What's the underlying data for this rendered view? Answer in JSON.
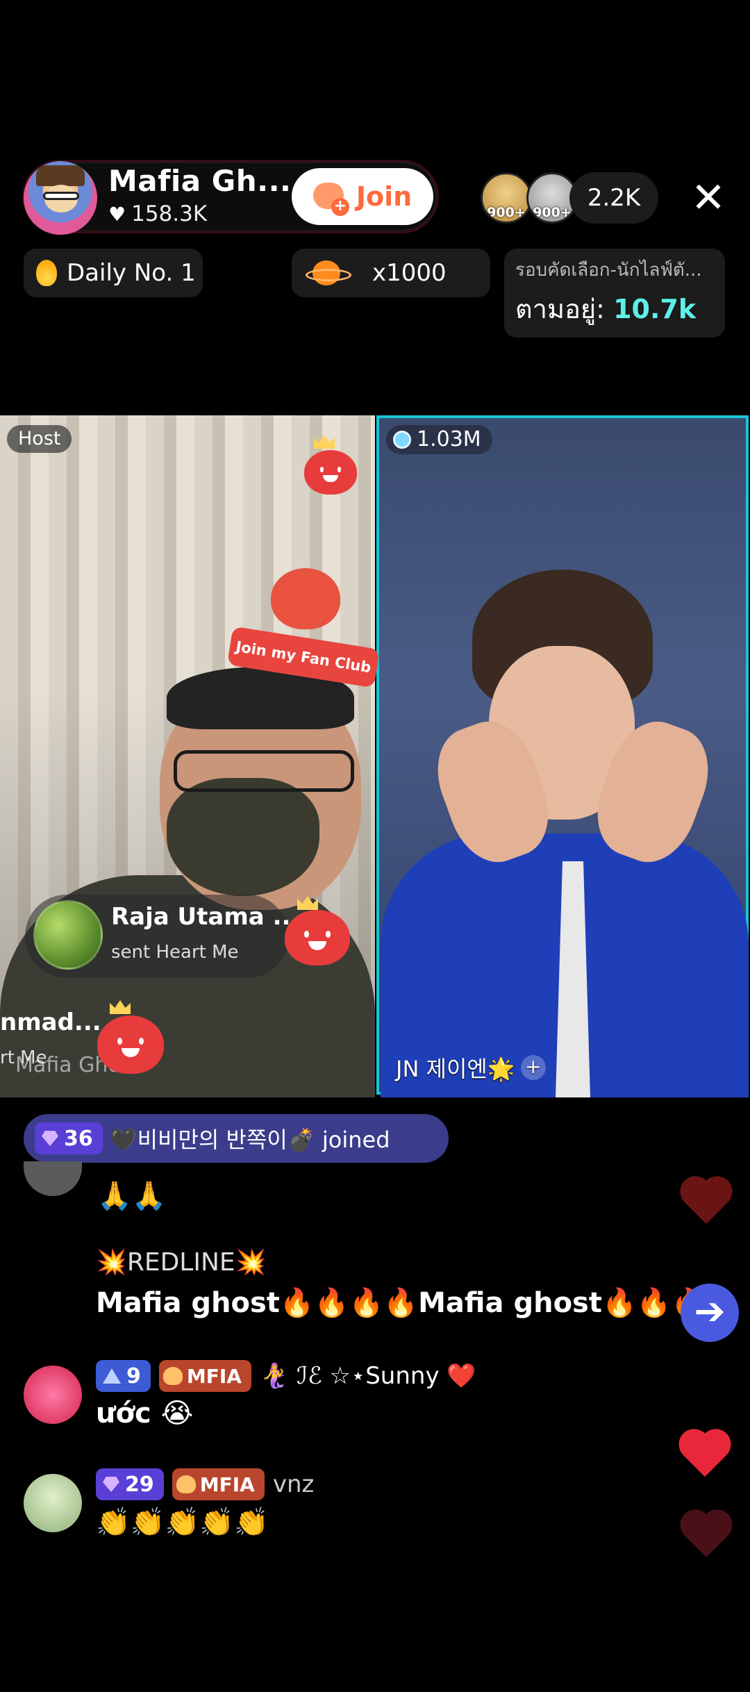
{
  "header": {
    "host_name": "Mafia Gh...",
    "host_likes": "158.3K",
    "join_label": "Join",
    "viewer_badges": [
      "900+",
      "900+"
    ],
    "viewer_count": "2.2K",
    "close_icon": "close-icon",
    "daily_rank": "Daily No. 1",
    "multiplier": "x1000",
    "ranking_title": "รอบคัดเลือก-นักไลฟ์ตั...",
    "ranking_label": "ตามอยู่:",
    "ranking_value": "10.7k"
  },
  "stream": {
    "host_tag": "Host",
    "guest_score": "1.03M",
    "guest_name": "JN 제이엔🌟",
    "fan_club_label": "Join my Fan Club",
    "gift": {
      "sender": "Raja Utama ...",
      "action": "sent Heart Me"
    },
    "gift2": {
      "sender": "nmad...",
      "action": "rt Me"
    },
    "watermark": "Mafia Ghost"
  },
  "chat": {
    "joined": {
      "level": "36",
      "text": "🖤비비만의 반쪽이💣 joined"
    },
    "messages": [
      {
        "user": "",
        "text": "🙏🙏"
      },
      {
        "user": "💥REDLINE💥",
        "text": "Mafia ghost🔥🔥🔥🔥Mafia ghost🔥🔥🔥🔥"
      },
      {
        "level": "9",
        "badge": "MFIA",
        "user": "🧜‍♀️ ℐℰ ☆⋆Sunny ❤️",
        "text": "ước 😭"
      },
      {
        "level": "29",
        "badge": "MFIA",
        "user": "vnz",
        "text": "👏👏👏👏👏"
      }
    ]
  },
  "colors": {
    "accent_cyan": "#17c6d8",
    "ranking_value": "#5ef0e8",
    "join_text": "#ff6a3d",
    "joined_pill": "#3b3d8c",
    "like_heart": "#e8283a"
  }
}
